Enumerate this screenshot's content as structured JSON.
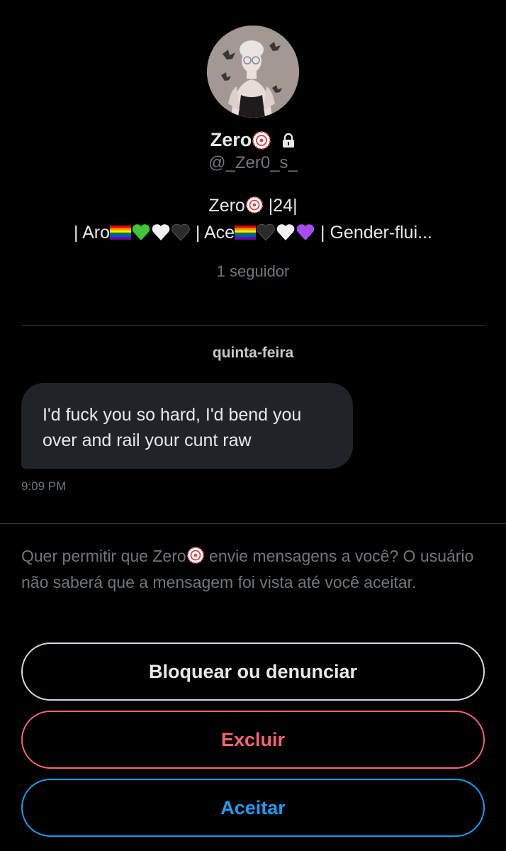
{
  "profile": {
    "display_name": "Zero",
    "display_name_emoji": "rosette-icon",
    "lock_icon": "lock-icon",
    "handle": "@_Zer0_s_",
    "bio_line1_name": "Zero",
    "bio_line1_age": "|24|",
    "bio_line2": {
      "aro_prefix": "| Aro",
      "ace_prefix": " | Ace",
      "gender_suffix": " | Gender-flui..."
    },
    "followers": "1 seguidor"
  },
  "conversation": {
    "date_separator": "quinta-feira",
    "messages": [
      {
        "text": "I'd fuck you so hard, I'd bend you over and rail your cunt raw",
        "time": "9:09 PM"
      }
    ]
  },
  "request": {
    "prompt_before": "Quer permitir que Zero",
    "prompt_after": " envie mensagens a você? O usuário não saberá que a mensagem foi vista até você aceitar."
  },
  "actions": {
    "block_label": "Bloquear ou denunciar",
    "delete_label": "Excluir",
    "accept_label": "Aceitar"
  },
  "colors": {
    "background": "#000000",
    "muted_text": "#71767b",
    "bubble": "#202327",
    "danger": "#f4646f",
    "accent": "#1d9bf0"
  }
}
